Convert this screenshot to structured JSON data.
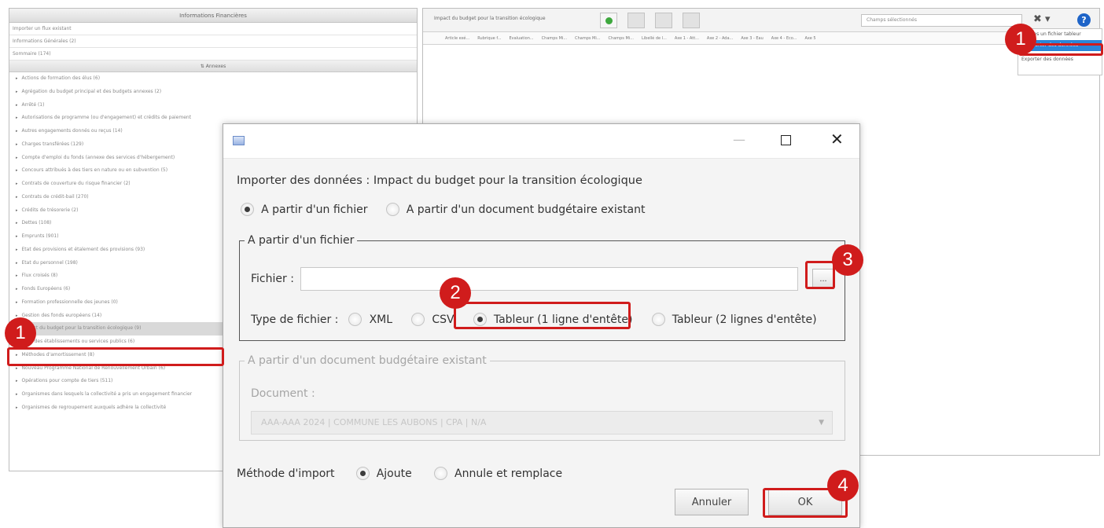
{
  "background": {
    "left_panel": {
      "title": "Informations Financières",
      "rows": [
        "Importer un flux existant",
        "Informations Générales (2)",
        "Sommaire (174)"
      ],
      "subheader": "Annexes",
      "items": [
        "Actions de formation des élus (6)",
        "Agrégation du budget principal et des budgets annexes (2)",
        "Arrêté (1)",
        "Autorisations de programme (ou d'engagement) et crédits de paiement",
        "Autres engagements donnés ou reçus (14)",
        "Charges transférées (129)",
        "Compte d'emploi du fonds (annexe des services d'hébergement)",
        "Concours attribués à des tiers en nature ou en subvention (5)",
        "Contrats de couverture du risque financier (2)",
        "Contrats de crédit-bail (270)",
        "Crédits de trésorerie (2)",
        "Dettes (108)",
        "Emprunts (901)",
        "Etat des provisions et étalement des provisions (93)",
        "Etat du personnel (198)",
        "Flux croisés (8)",
        "Fonds Européens (6)",
        "Formation professionnelle des jeunes (0)",
        "Gestion des fonds européens (14)",
        "Impact du budget pour la transition écologique (9)",
        "Liste des établissements ou services publics (6)",
        "Méthodes d'amortissement (8)",
        "Nouveau Programme National de Renouvellement Urbain (6)",
        "Opérations pour compte de tiers (511)",
        "Organismes dans lesquels la collectivité a pris un engagement financier",
        "Organismes de regroupement auxquels adhère la collectivité"
      ],
      "selected_index": 19
    },
    "right_panel": {
      "title": "Impact du budget pour la transition écologique",
      "select_placeholder": "Champs sélectionnés",
      "tool_icon": "✖ ▾",
      "help_icon": "?",
      "columns": [
        "Article exé...",
        "Rubrique f...",
        "Evaluation...",
        "Champs Mi...",
        "Champs Mi...",
        "Champs Mi...",
        "Libellé de l...",
        "Axe 1 - Att...",
        "Axe 2 - Ada...",
        "Axe 3 - Eau",
        "Axe 4 - Eco...",
        "Axe 5"
      ]
    },
    "menu": {
      "item_partial": "...ées un fichier tableur",
      "item_selected": "Importer des données",
      "item_export": "Exporter des données"
    }
  },
  "annotations": [
    "1",
    "1",
    "2",
    "3",
    "4"
  ],
  "dialog": {
    "title_buttons": {
      "minimize": "—",
      "maximize": "",
      "close": "✕"
    },
    "heading": "Importer des données : Impact du budget pour la transition écologique",
    "source_options": [
      {
        "label": "A partir d'un fichier",
        "selected": true
      },
      {
        "label": "A partir d'un document budgétaire existant",
        "selected": false
      }
    ],
    "file_section": {
      "legend": "A partir d'un fichier",
      "file_label": "Fichier :",
      "file_value": "",
      "browse_label": "...",
      "type_label": "Type de fichier :",
      "types": [
        {
          "label": "XML",
          "selected": false
        },
        {
          "label": "CSV",
          "selected": false
        },
        {
          "label": "Tableur (1 ligne d'entête)",
          "selected": true
        },
        {
          "label": "Tableur (2 lignes d'entête)",
          "selected": false
        }
      ]
    },
    "doc_section": {
      "legend": "A partir d'un document budgétaire existant",
      "document_label": "Document :",
      "document_value": "AAA-AAA 2024 | COMMUNE LES AUBONS | CPA | N/A",
      "arrow": "▼"
    },
    "import_method": {
      "label": "Méthode d'import",
      "options": [
        {
          "label": "Ajoute",
          "selected": true
        },
        {
          "label": "Annule et remplace",
          "selected": false
        }
      ]
    },
    "buttons": {
      "cancel": "Annuler",
      "ok": "OK"
    }
  },
  "colors": {
    "annotation_red": "#d01c1c",
    "menu_highlight": "#2a85d8",
    "help_blue": "#1e64c8",
    "add_green": "#3ea83e"
  }
}
